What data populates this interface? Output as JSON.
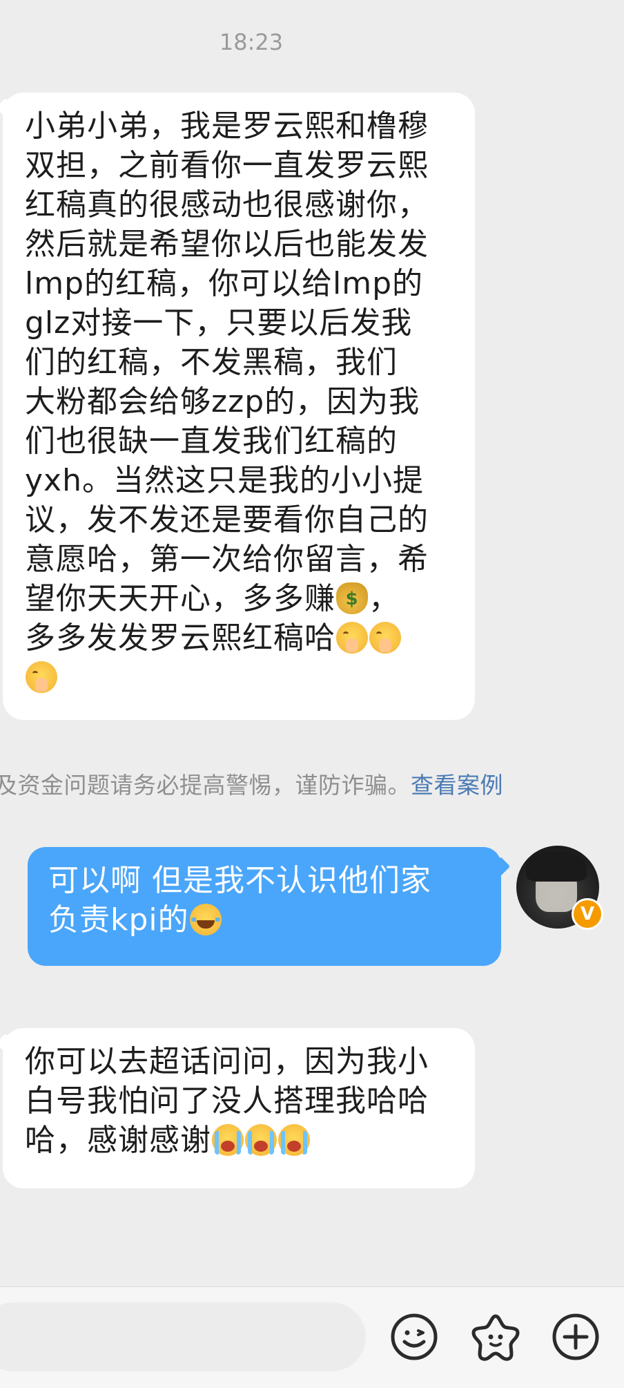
{
  "chat": {
    "timestamp": "18:23",
    "messages": [
      {
        "direction": "incoming",
        "lines": [
          "小弟小弟，我是罗云熙和橹穆",
          "双担，之前看你一直发罗云熙",
          "红稿真的很感动也很感谢你，",
          "然后就是希望你以后也能发发",
          "lmp的红稿，你可以给lmp的",
          "glz对接一下，只要以后发我",
          "们的红稿，不发黑稿，我们",
          "大粉都会给够zzp的，因为我",
          "们也很缺一直发我们红稿的",
          "yxh。当然这只是我的小小提",
          "议，发不发还是要看你自己的",
          "意愿哈，第一次给你留言，希",
          "望你天天开心，多多赚",
          "，",
          "多多发发罗云熙红稿哈"
        ]
      },
      {
        "direction": "outgoing",
        "lines": [
          "可以啊 但是我不认识他们家",
          "负责kpi的"
        ]
      },
      {
        "direction": "incoming",
        "lines": [
          "你可以去超话问问，因为我小",
          "白号我怕问了没人搭理我哈哈",
          "哈，感谢感谢"
        ]
      }
    ],
    "notice": {
      "text": "及资金问题请务必提高警惕，谨防诈骗。",
      "link": "查看案例"
    },
    "avatar": {
      "badge": "V",
      "badge_color": "#f59b00"
    }
  },
  "input_bar": {
    "placeholder": "",
    "icons": [
      "smiley-face-icon",
      "sticker-star-icon",
      "plus-circle-icon"
    ]
  },
  "colors": {
    "background": "#ededed",
    "incoming_bubble": "#ffffff",
    "outgoing_bubble": "#4aa6fa",
    "link": "#4a7ab4"
  },
  "emojis": {
    "money_bag": "money-bag-emoji",
    "pray_face": "face-with-hand-over-mouth-emoji",
    "laugh_cry": "laughing-crying-emoji",
    "loud_cry": "loudly-crying-emoji"
  }
}
